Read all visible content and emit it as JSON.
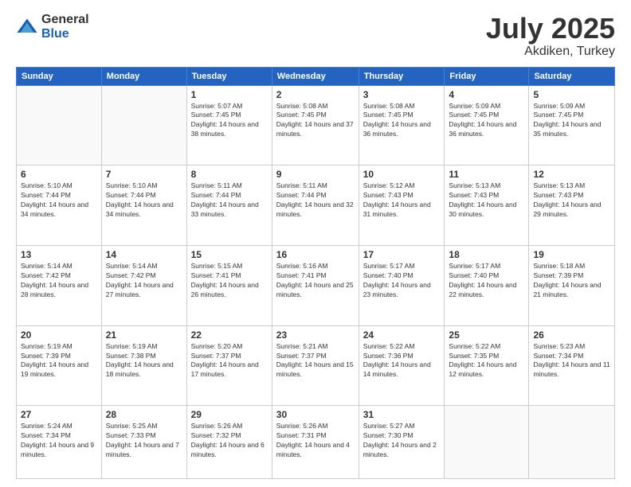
{
  "logo": {
    "general": "General",
    "blue": "Blue"
  },
  "header": {
    "month": "July 2025",
    "location": "Akdiken, Turkey"
  },
  "days_of_week": [
    "Sunday",
    "Monday",
    "Tuesday",
    "Wednesday",
    "Thursday",
    "Friday",
    "Saturday"
  ],
  "weeks": [
    [
      {
        "day": "",
        "sunrise": "",
        "sunset": "",
        "daylight": ""
      },
      {
        "day": "",
        "sunrise": "",
        "sunset": "",
        "daylight": ""
      },
      {
        "day": "1",
        "sunrise": "Sunrise: 5:07 AM",
        "sunset": "Sunset: 7:45 PM",
        "daylight": "Daylight: 14 hours and 38 minutes."
      },
      {
        "day": "2",
        "sunrise": "Sunrise: 5:08 AM",
        "sunset": "Sunset: 7:45 PM",
        "daylight": "Daylight: 14 hours and 37 minutes."
      },
      {
        "day": "3",
        "sunrise": "Sunrise: 5:08 AM",
        "sunset": "Sunset: 7:45 PM",
        "daylight": "Daylight: 14 hours and 36 minutes."
      },
      {
        "day": "4",
        "sunrise": "Sunrise: 5:09 AM",
        "sunset": "Sunset: 7:45 PM",
        "daylight": "Daylight: 14 hours and 36 minutes."
      },
      {
        "day": "5",
        "sunrise": "Sunrise: 5:09 AM",
        "sunset": "Sunset: 7:45 PM",
        "daylight": "Daylight: 14 hours and 35 minutes."
      }
    ],
    [
      {
        "day": "6",
        "sunrise": "Sunrise: 5:10 AM",
        "sunset": "Sunset: 7:44 PM",
        "daylight": "Daylight: 14 hours and 34 minutes."
      },
      {
        "day": "7",
        "sunrise": "Sunrise: 5:10 AM",
        "sunset": "Sunset: 7:44 PM",
        "daylight": "Daylight: 14 hours and 34 minutes."
      },
      {
        "day": "8",
        "sunrise": "Sunrise: 5:11 AM",
        "sunset": "Sunset: 7:44 PM",
        "daylight": "Daylight: 14 hours and 33 minutes."
      },
      {
        "day": "9",
        "sunrise": "Sunrise: 5:11 AM",
        "sunset": "Sunset: 7:44 PM",
        "daylight": "Daylight: 14 hours and 32 minutes."
      },
      {
        "day": "10",
        "sunrise": "Sunrise: 5:12 AM",
        "sunset": "Sunset: 7:43 PM",
        "daylight": "Daylight: 14 hours and 31 minutes."
      },
      {
        "day": "11",
        "sunrise": "Sunrise: 5:13 AM",
        "sunset": "Sunset: 7:43 PM",
        "daylight": "Daylight: 14 hours and 30 minutes."
      },
      {
        "day": "12",
        "sunrise": "Sunrise: 5:13 AM",
        "sunset": "Sunset: 7:43 PM",
        "daylight": "Daylight: 14 hours and 29 minutes."
      }
    ],
    [
      {
        "day": "13",
        "sunrise": "Sunrise: 5:14 AM",
        "sunset": "Sunset: 7:42 PM",
        "daylight": "Daylight: 14 hours and 28 minutes."
      },
      {
        "day": "14",
        "sunrise": "Sunrise: 5:14 AM",
        "sunset": "Sunset: 7:42 PM",
        "daylight": "Daylight: 14 hours and 27 minutes."
      },
      {
        "day": "15",
        "sunrise": "Sunrise: 5:15 AM",
        "sunset": "Sunset: 7:41 PM",
        "daylight": "Daylight: 14 hours and 26 minutes."
      },
      {
        "day": "16",
        "sunrise": "Sunrise: 5:16 AM",
        "sunset": "Sunset: 7:41 PM",
        "daylight": "Daylight: 14 hours and 25 minutes."
      },
      {
        "day": "17",
        "sunrise": "Sunrise: 5:17 AM",
        "sunset": "Sunset: 7:40 PM",
        "daylight": "Daylight: 14 hours and 23 minutes."
      },
      {
        "day": "18",
        "sunrise": "Sunrise: 5:17 AM",
        "sunset": "Sunset: 7:40 PM",
        "daylight": "Daylight: 14 hours and 22 minutes."
      },
      {
        "day": "19",
        "sunrise": "Sunrise: 5:18 AM",
        "sunset": "Sunset: 7:39 PM",
        "daylight": "Daylight: 14 hours and 21 minutes."
      }
    ],
    [
      {
        "day": "20",
        "sunrise": "Sunrise: 5:19 AM",
        "sunset": "Sunset: 7:39 PM",
        "daylight": "Daylight: 14 hours and 19 minutes."
      },
      {
        "day": "21",
        "sunrise": "Sunrise: 5:19 AM",
        "sunset": "Sunset: 7:38 PM",
        "daylight": "Daylight: 14 hours and 18 minutes."
      },
      {
        "day": "22",
        "sunrise": "Sunrise: 5:20 AM",
        "sunset": "Sunset: 7:37 PM",
        "daylight": "Daylight: 14 hours and 17 minutes."
      },
      {
        "day": "23",
        "sunrise": "Sunrise: 5:21 AM",
        "sunset": "Sunset: 7:37 PM",
        "daylight": "Daylight: 14 hours and 15 minutes."
      },
      {
        "day": "24",
        "sunrise": "Sunrise: 5:22 AM",
        "sunset": "Sunset: 7:36 PM",
        "daylight": "Daylight: 14 hours and 14 minutes."
      },
      {
        "day": "25",
        "sunrise": "Sunrise: 5:22 AM",
        "sunset": "Sunset: 7:35 PM",
        "daylight": "Daylight: 14 hours and 12 minutes."
      },
      {
        "day": "26",
        "sunrise": "Sunrise: 5:23 AM",
        "sunset": "Sunset: 7:34 PM",
        "daylight": "Daylight: 14 hours and 11 minutes."
      }
    ],
    [
      {
        "day": "27",
        "sunrise": "Sunrise: 5:24 AM",
        "sunset": "Sunset: 7:34 PM",
        "daylight": "Daylight: 14 hours and 9 minutes."
      },
      {
        "day": "28",
        "sunrise": "Sunrise: 5:25 AM",
        "sunset": "Sunset: 7:33 PM",
        "daylight": "Daylight: 14 hours and 7 minutes."
      },
      {
        "day": "29",
        "sunrise": "Sunrise: 5:26 AM",
        "sunset": "Sunset: 7:32 PM",
        "daylight": "Daylight: 14 hours and 6 minutes."
      },
      {
        "day": "30",
        "sunrise": "Sunrise: 5:26 AM",
        "sunset": "Sunset: 7:31 PM",
        "daylight": "Daylight: 14 hours and 4 minutes."
      },
      {
        "day": "31",
        "sunrise": "Sunrise: 5:27 AM",
        "sunset": "Sunset: 7:30 PM",
        "daylight": "Daylight: 14 hours and 2 minutes."
      },
      {
        "day": "",
        "sunrise": "",
        "sunset": "",
        "daylight": ""
      },
      {
        "day": "",
        "sunrise": "",
        "sunset": "",
        "daylight": ""
      }
    ]
  ]
}
